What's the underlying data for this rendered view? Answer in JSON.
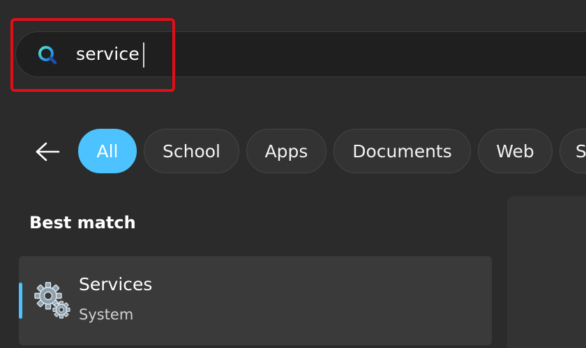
{
  "search": {
    "query": "service",
    "icon": "search-icon"
  },
  "filters": {
    "back_icon": "back-arrow-icon",
    "chips": [
      {
        "label": "All",
        "active": true
      },
      {
        "label": "School",
        "active": false
      },
      {
        "label": "Apps",
        "active": false
      },
      {
        "label": "Documents",
        "active": false
      },
      {
        "label": "Web",
        "active": false
      },
      {
        "label": "S",
        "active": false
      }
    ]
  },
  "results": {
    "section_heading": "Best match",
    "best_match": {
      "title": "Services",
      "subtitle": "System",
      "icon": "gears-icon"
    }
  },
  "colors": {
    "accent": "#4cc2ff",
    "highlight": "#e10e17",
    "background": "#2b2b2b"
  }
}
